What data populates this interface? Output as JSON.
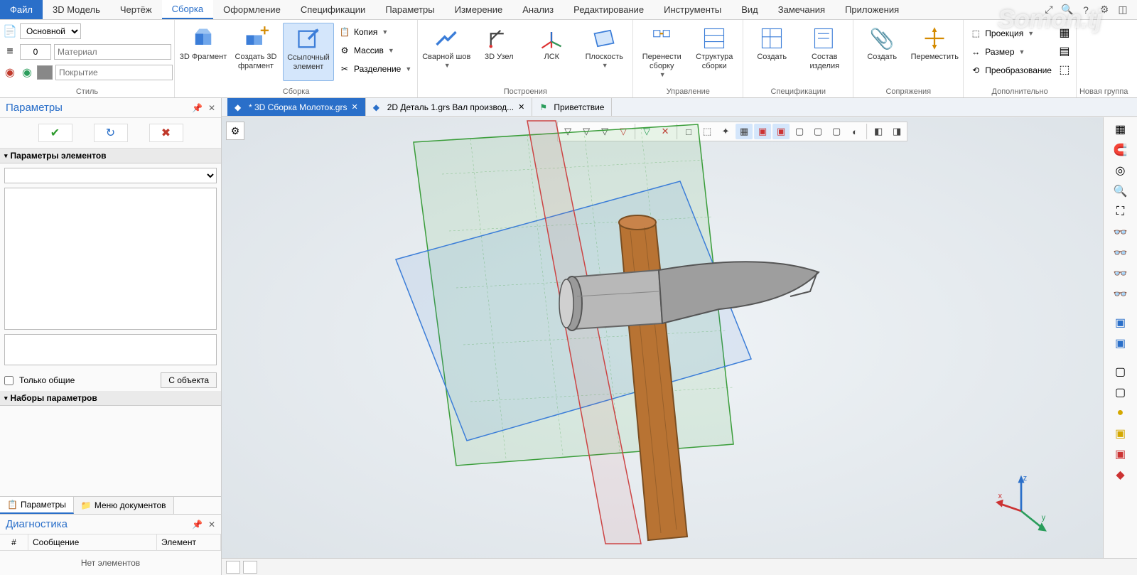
{
  "menu": {
    "file": "Файл",
    "items": [
      "3D Модель",
      "Чертёж",
      "Сборка",
      "Оформление",
      "Спецификации",
      "Параметры",
      "Измерение",
      "Анализ",
      "Редактирование",
      "Инструменты",
      "Вид",
      "Замечания",
      "Приложения"
    ],
    "active_index": 2
  },
  "style_panel": {
    "main_value": "Основной",
    "number_value": "0",
    "material_placeholder": "Материал",
    "cover_placeholder": "Покрытие",
    "group_label": "Стиль"
  },
  "ribbon": {
    "assembly": {
      "fragment3d": "3D\nФрагмент",
      "create3d": "Создать 3D\nфрагмент",
      "ref_elem": "Ссылочный\nэлемент",
      "copy": "Копия",
      "array": "Массив",
      "split": "Разделение",
      "group_label": "Сборка"
    },
    "build": {
      "weld": "Сварной\nшов",
      "node3d": "3D\nУзел",
      "lcs": "ЛСК",
      "plane": "Плоскость",
      "group_label": "Построения"
    },
    "manage": {
      "move_asm": "Перенести\nсборку",
      "struct": "Структура\nсборки",
      "group_label": "Управление"
    },
    "spec": {
      "create": "Создать",
      "bom": "Состав\nизделия",
      "group_label": "Спецификации"
    },
    "mate": {
      "create": "Создать",
      "move": "Переместить",
      "group_label": "Сопряжения"
    },
    "extra": {
      "proj": "Проекция",
      "size": "Размер",
      "transform": "Преобразование",
      "group_label": "Дополнительно"
    },
    "newgroup": "Новая группа"
  },
  "doctabs": [
    {
      "label": "* 3D Сборка Молоток.grs",
      "active": true
    },
    {
      "label": "2D Деталь 1.grs  Вал производ...",
      "active": false
    },
    {
      "label": "Приветствие",
      "active": false
    }
  ],
  "params_panel": {
    "title": "Параметры",
    "section_elems": "Параметры элементов",
    "only_common": "Только общие",
    "from_object": "С объекта",
    "section_sets": "Наборы параметров",
    "tab_params": "Параметры",
    "tab_docs": "Меню документов"
  },
  "diag_panel": {
    "title": "Диагностика",
    "col_num": "#",
    "col_msg": "Сообщение",
    "col_elem": "Элемент",
    "empty": "Нет элементов"
  },
  "gizmo": {
    "x": "x",
    "y": "y",
    "z": "z"
  },
  "watermark": "Somon.tj"
}
